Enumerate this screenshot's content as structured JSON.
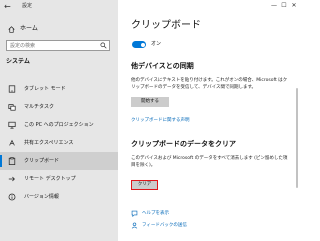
{
  "window": {
    "title": "設定",
    "back_label": "←"
  },
  "sidebar": {
    "home_label": "ホーム",
    "search_placeholder": "設定の検索",
    "section_title": "システム",
    "items": [
      {
        "label": "タブレット モード",
        "icon": "tablet-mode-icon"
      },
      {
        "label": "マルチタスク",
        "icon": "multitasking-icon"
      },
      {
        "label": "この PC へのプロジェクション",
        "icon": "projecting-icon"
      },
      {
        "label": "共有エクスペリエンス",
        "icon": "shared-experiences-icon"
      },
      {
        "label": "クリップボード",
        "icon": "clipboard-icon",
        "active": true
      },
      {
        "label": "リモート デスクトップ",
        "icon": "remote-desktop-icon"
      },
      {
        "label": "バージョン情報",
        "icon": "about-icon"
      }
    ]
  },
  "main": {
    "title": "クリップボード",
    "toggle_state": "オン",
    "sync": {
      "heading": "他デバイスとの同期",
      "description": "他のデバイスにテキストを貼り付けます。これがオンの場合、Microsoft はクリップボードのデータを受信して、デバイス間で同期します。",
      "start_button": "開始する",
      "privacy_link": "クリップボードに関する声明"
    },
    "clear": {
      "heading": "クリップボードのデータをクリア",
      "description": "このデバイスおよび Microsoft のデータをすべて消去します (ピン留めした項目を除く)。",
      "clear_button": "クリア"
    },
    "help_link": "ヘルプを表示",
    "feedback_link": "フィードバックの送信"
  },
  "colors": {
    "accent": "#0078d7",
    "highlight_border": "#e0161b",
    "link": "#0067b8",
    "sidebar_bg": "#e6e6e6"
  }
}
